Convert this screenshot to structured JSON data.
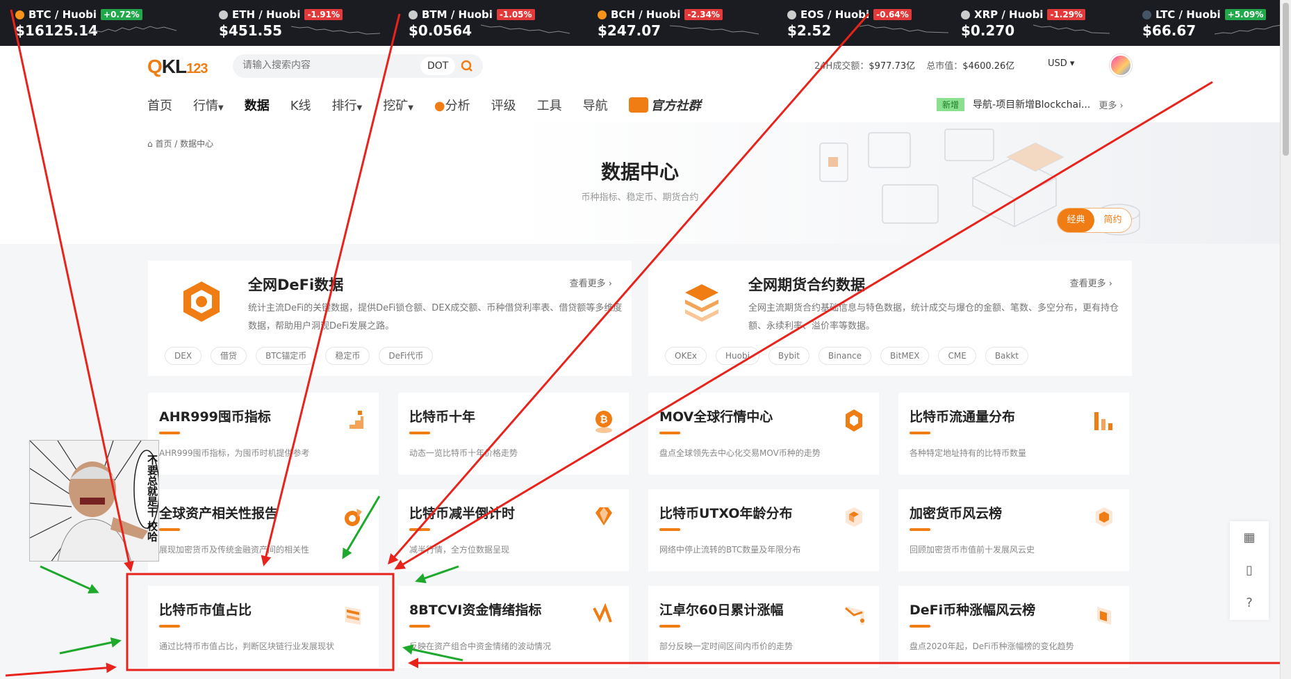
{
  "ticker": [
    {
      "pair": "BTC / Huobi",
      "change": "+0.72%",
      "dir": "up",
      "price": "$16125.14"
    },
    {
      "pair": "ETH / Huobi",
      "change": "-1.91%",
      "dir": "down",
      "price": "$451.55"
    },
    {
      "pair": "BTM / Huobi",
      "change": "-1.05%",
      "dir": "down",
      "price": "$0.0564"
    },
    {
      "pair": "BCH / Huobi",
      "change": "-2.34%",
      "dir": "down",
      "price": "$247.07"
    },
    {
      "pair": "EOS / Huobi",
      "change": "-0.64%",
      "dir": "down",
      "price": "$2.52"
    },
    {
      "pair": "XRP / Huobi",
      "change": "-1.29%",
      "dir": "down",
      "price": "$0.270"
    },
    {
      "pair": "LTC / Huobi",
      "change": "+5.09%",
      "dir": "up",
      "price": "$66.67"
    }
  ],
  "header": {
    "logo_q": "Q",
    "logo_kl": "KL",
    "logo_num": "123",
    "search_placeholder": "请输入搜索内容",
    "search_tag": "DOT",
    "volume_label": "24H成交额：",
    "volume_value": "$977.73亿",
    "mcap_label": "总市值：",
    "mcap_value": "$4600.26亿",
    "currency": "USD"
  },
  "nav": {
    "items": [
      "首页",
      "行情",
      "数据",
      "K线",
      "排行",
      "挖矿",
      "分析",
      "评级",
      "工具",
      "导航"
    ],
    "official": "官方社群",
    "news_badge": "新增",
    "news_text": "导航-项目新增Blockchai...",
    "news_more": "更多"
  },
  "hero": {
    "breadcrumb_home": "首页",
    "breadcrumb_sep": "/",
    "breadcrumb_current": "数据中心",
    "title": "数据中心",
    "subtitle": "币种指标、稳定币、期货合约",
    "toggle_a": "经典",
    "toggle_b": "简约"
  },
  "big_cards": [
    {
      "title": "全网DeFi数据",
      "more": "查看更多",
      "desc": "统计主流DeFi的关键数据，提供DeFi锁仓额、DEX成交额、币种借贷利率表、借贷额等多维度数据，帮助用户洞观DeFi发展之路。",
      "tags": [
        "DEX",
        "借贷",
        "BTC锚定币",
        "稳定币",
        "DeFi代币"
      ]
    },
    {
      "title": "全网期货合约数据",
      "more": "查看更多",
      "desc": "全网主流期货合约基础信息与特色数据，统计成交与爆仓的金额、笔数、多空分布，更有持仓额、永续利率、溢价率等数据。",
      "tags": [
        "OKEx",
        "Huobi",
        "Bybit",
        "Binance",
        "BitMEX",
        "CME",
        "Bakkt"
      ]
    }
  ],
  "cards": [
    {
      "title": "AHR999囤币指标",
      "desc": "AHR999囤币指标，为囤币时机提供参考"
    },
    {
      "title": "比特币十年",
      "desc": "动态一览比特币十年价格走势"
    },
    {
      "title": "MOV全球行情中心",
      "desc": "盘点全球领先去中心化交易MOV币种的走势"
    },
    {
      "title": "比特币流通量分布",
      "desc": "各种特定地址持有的比特币数量"
    },
    {
      "title": "全球资产相关性报告",
      "desc": "展现加密货币及传统金融资产间的相关性"
    },
    {
      "title": "比特币减半倒计时",
      "desc": "减半行情，全方位数据呈现"
    },
    {
      "title": "比特币UTXO年龄分布",
      "desc": "网络中停止流转的BTC数量及年限分布"
    },
    {
      "title": "加密货币风云榜",
      "desc": "回顾加密货币市值前十发展风云史"
    },
    {
      "title": "比特币市值占比",
      "desc": "通过比特币市值占比，判断区块链行业发展现状"
    },
    {
      "title": "8BTCVI资金情绪指标",
      "desc": "反映在资产组合中资金情绪的波动情况"
    },
    {
      "title": "江卓尔60日累计涨幅",
      "desc": "部分反映一定时间区间内币价的走势"
    },
    {
      "title": "DeFi币种涨幅风云榜",
      "desc": "盘点2020年起，DeFi币种涨幅榜的变化趋势"
    }
  ],
  "meme": {
    "caption": "不要总就是干 校哈"
  },
  "side_tools": [
    "qr-code-icon",
    "mobile-icon",
    "help-icon"
  ],
  "colors": {
    "accent": "#f07c14",
    "up": "#21a84a",
    "down": "#e23a3a",
    "arrow_red": "#e8231c",
    "arrow_green": "#1ea82c"
  }
}
